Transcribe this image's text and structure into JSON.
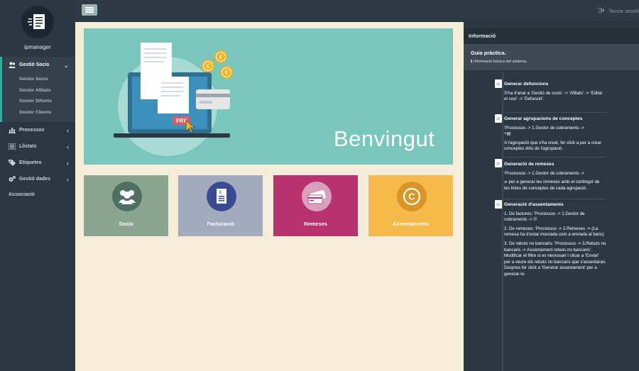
{
  "app": {
    "logo_text": "ipmanager"
  },
  "sidebar": {
    "active": {
      "label": "Gestió Socis"
    },
    "subitems": [
      "Gestor Socis",
      "Gestor Afiliats",
      "Gestor Difunts",
      "Gestor Clients"
    ],
    "items": [
      {
        "label": "Processos",
        "icon": "bar-chart-icon"
      },
      {
        "label": "Llistats",
        "icon": "list-icon"
      },
      {
        "label": "Etiquetes",
        "icon": "tag-icon"
      },
      {
        "label": "Gestió dades",
        "icon": "cogs-icon"
      }
    ],
    "plain_item": "Associació"
  },
  "topbar": {
    "logout_label": "Tancar sessió"
  },
  "hero": {
    "title": "Benvingut",
    "pay_label": "PAY"
  },
  "tiles": [
    {
      "label": "Socis",
      "color": "#8aa691",
      "circle": "#4f6f63"
    },
    {
      "label": "Facturació",
      "color": "#a2aabd",
      "circle": "#3a4a93"
    },
    {
      "label": "Remeses",
      "color": "#b8336e",
      "circle": "#d9a0bd"
    },
    {
      "label": "Assentaments",
      "color": "#f8b94c",
      "circle": "#d99627"
    }
  ],
  "panel": {
    "title": "Informació",
    "guide_title": "Guia pràctica.",
    "guide_sub": "Informació bàsica del sistema.",
    "entries": [
      {
        "title": "Generar defuncions",
        "lines": [
          "S'ha d'anar a 'Gestió de socis' -> 'Afiliats' -> 'Editar el soci' -> 'Defunció'."
        ]
      },
      {
        "title": "Generar agrupacions de conceptes",
        "lines": [
          "'Processos -> 1.Gestor de cobraments ->",
          "A l'agrupació que s'ha creat, fer click a per a crear conceptes dins de l'agrupació."
        ]
      },
      {
        "title": "Generació de remeses",
        "lines": [
          "'Processos -> 1.Gestor de cobraments ->",
          "per a generar les remeses amb el contingut de les línies de conceptes de cada agrupació."
        ]
      },
      {
        "title": "Generació d'assentaments",
        "lines": [
          "1. De factures: 'Processos -> 1.Gestor de cobraments ->",
          "2. De remeses: 'Processos -> 2.Remeses -> (La remesa ha d'estar marcada com a enviada al banc)",
          "3. De rebuts no bancaris: 'Processos -> 3.Rebuts no bancaris -> Assentament rebuts no bancaris'. Modificar el filtre si es necessari i clicar a 'Enviar' per a veure els rebuts no bancaris que s'assentaran. Despres fer click a 'Generar assentament' per a generar-lo."
        ]
      }
    ]
  }
}
